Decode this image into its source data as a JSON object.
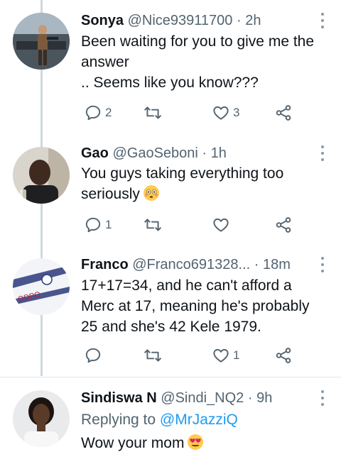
{
  "tweets": [
    {
      "name": "Sonya",
      "handle": "@Nice93911700",
      "dot": "·",
      "time": "2h",
      "lines": [
        "Been waiting for you to give me the",
        "answer",
        ".. Seems like you know???"
      ],
      "reply_count": "2",
      "retweet_count": "",
      "like_count": "3"
    },
    {
      "name": "Gao",
      "handle": "@GaoSeboni",
      "dot": "·",
      "time": "1h",
      "lines": [
        "You guys taking everything too",
        "seriously"
      ],
      "emoji": "flushed-face-emoji",
      "reply_count": "1",
      "retweet_count": "",
      "like_count": ""
    },
    {
      "name": "Franco",
      "handle": "@Franco691328...",
      "dot": "·",
      "time": "18m",
      "lines": [
        "17+17=34, and he can't afford a",
        "Merc at 17, meaning he's probably",
        "25 and she's 42 Kele 1979."
      ],
      "reply_count": "",
      "retweet_count": "",
      "like_count": "1"
    },
    {
      "name": "Sindiswa N",
      "handle": "@Sindi_NQ2",
      "dot": "·",
      "time": "9h",
      "replying_prefix": "Replying to",
      "replying_to": "@MrJazziQ",
      "lines": [
        "Wow your mom"
      ],
      "emoji": "heart-eyes-emoji"
    }
  ],
  "icons": {
    "reply": "reply-icon",
    "retweet": "retweet-icon",
    "like": "heart-icon",
    "share": "share-icon",
    "more": "more-options-icon"
  },
  "colors": {
    "text": "#0f1419",
    "secondary": "#536471",
    "link": "#1d9bf0",
    "thread_line": "#cfd9de",
    "divider": "#e1e8ed"
  }
}
